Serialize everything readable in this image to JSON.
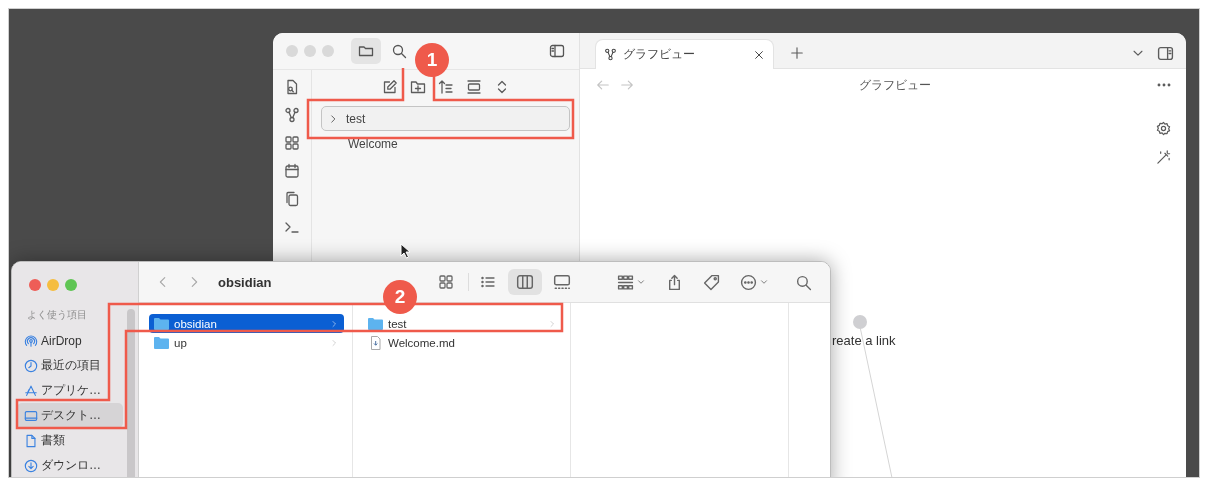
{
  "obsidian": {
    "file_tree": [
      {
        "name": "test",
        "kind": "folder",
        "selected": true
      },
      {
        "name": "Welcome",
        "kind": "file",
        "selected": false
      }
    ],
    "tabs": [
      {
        "label": "グラフビュー",
        "selected": true
      }
    ],
    "view_title": "グラフビュー",
    "graph": {
      "nodes": [
        {
          "label": "reate a link"
        }
      ]
    }
  },
  "finder": {
    "title": "obsidian",
    "sidebar": {
      "heading": "よく使う項目",
      "items": [
        {
          "label": "AirDrop",
          "kind": "airdrop",
          "selected": false
        },
        {
          "label": "最近の項目",
          "kind": "recent",
          "selected": false
        },
        {
          "label": "アプリケ…",
          "kind": "apps",
          "selected": false
        },
        {
          "label": "デスクト…",
          "kind": "desktop",
          "selected": true
        },
        {
          "label": "書類",
          "kind": "documents",
          "selected": false
        },
        {
          "label": "ダウンロ…",
          "kind": "downloads",
          "selected": false
        }
      ]
    },
    "columns": [
      {
        "items": [
          {
            "name": "obsidian",
            "kind": "folder",
            "selected": true
          },
          {
            "name": "up",
            "kind": "folder",
            "selected": false
          }
        ]
      },
      {
        "items": [
          {
            "name": "test",
            "kind": "folder",
            "selected": false
          },
          {
            "name": "Welcome.md",
            "kind": "file",
            "selected": false
          }
        ]
      }
    ]
  },
  "annotations": [
    {
      "number": "1"
    },
    {
      "number": "2"
    }
  ]
}
